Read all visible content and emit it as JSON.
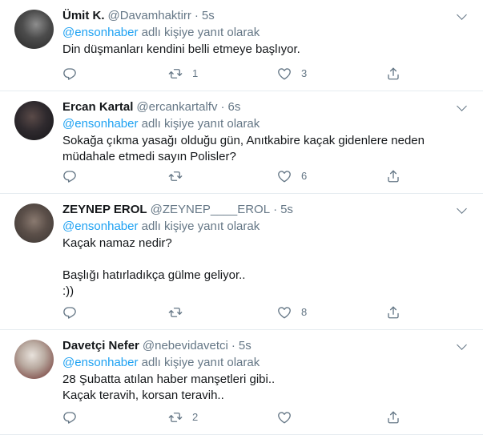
{
  "reply_prefix": "adlı kişiye yanıt olarak",
  "colors": {
    "link": "#1da1f2",
    "muted": "#657786",
    "text": "#14171a",
    "divider": "#e6ecf0"
  },
  "icons": [
    "reply-icon",
    "retweet-icon",
    "like-icon",
    "share-icon",
    "chevron-down-icon"
  ],
  "tweets": [
    {
      "name": "Ümit K.",
      "handle": "@Davamhaktirr",
      "time": "5s",
      "reply_to": "@ensonhaber",
      "lines": [
        "Din düşmanları kendini belli etmeye başlıyor."
      ],
      "replies": "",
      "retweets": "1",
      "likes": "3"
    },
    {
      "name": "Ercan Kartal",
      "handle": "@ercankartalfv",
      "time": "6s",
      "reply_to": "@ensonhaber",
      "lines": [
        "Sokağa çıkma yasağı olduğu gün, Anıtkabire kaçak gidenlere neden",
        "müdahale etmedi sayın Polisler?"
      ],
      "replies": "",
      "retweets": "",
      "likes": "6"
    },
    {
      "name": "ZEYNEP EROL",
      "handle": "@ZEYNEP____EROL",
      "time": "5s",
      "reply_to": "@ensonhaber",
      "lines": [
        "Kaçak namaz nedir?",
        "",
        "Başlığı hatırladıkça gülme geliyor..",
        ":))"
      ],
      "replies": "",
      "retweets": "",
      "likes": "8"
    },
    {
      "name": "Davetçi Nefer",
      "handle": "@nebevidavetci",
      "time": "5s",
      "reply_to": "@ensonhaber",
      "lines": [
        "28 Şubatta atılan haber manşetleri gibi..",
        "Kaçak teravih, korsan teravih.."
      ],
      "replies": "",
      "retweets": "2",
      "likes": ""
    }
  ]
}
